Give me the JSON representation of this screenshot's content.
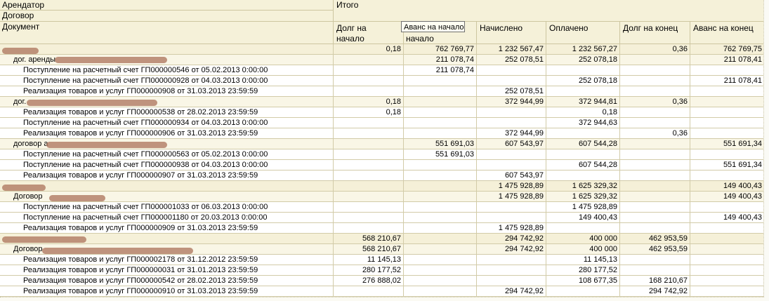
{
  "header": {
    "level1": "Арендатор",
    "level2": "Договор",
    "level3": "Документ",
    "group_title": "Итого",
    "columns": [
      "Долг на начало",
      "Аванс на начало",
      "Начислено",
      "Оплачено",
      "Долг на конец",
      "Аванс на конец"
    ],
    "col_debt_start_l1": "Долг на",
    "col_debt_start_l2": "начало",
    "col_adv_start_l2": "начало"
  },
  "tooltip": "Аванс на начало",
  "rows": [
    {
      "level": 1,
      "name": "",
      "v": [
        "0,18",
        "762 769,77",
        "1 232 567,47",
        "1 232 567,27",
        "0,36",
        "762 769,75"
      ]
    },
    {
      "level": 2,
      "name": "дог. аренды",
      "v": [
        "",
        "211 078,74",
        "252 078,51",
        "252 078,18",
        "",
        "211 078,41"
      ]
    },
    {
      "level": 3,
      "name": "Поступление на расчетный счет ГП000000546 от 05.02.2013 0:00:00",
      "v": [
        "",
        "211 078,74",
        "",
        "",
        "",
        ""
      ]
    },
    {
      "level": 3,
      "name": "Поступление на расчетный счет ГП000000928 от 04.03.2013 0:00:00",
      "v": [
        "",
        "",
        "",
        "252 078,18",
        "",
        "211 078,41"
      ]
    },
    {
      "level": 3,
      "name": "Реализация товаров и услуг ГП000000908 от 31.03.2013 23:59:59",
      "v": [
        "",
        "",
        "252 078,51",
        "",
        "",
        ""
      ]
    },
    {
      "level": 2,
      "name": "дог.",
      "v": [
        "0,18",
        "",
        "372 944,99",
        "372 944,81",
        "0,36",
        ""
      ]
    },
    {
      "level": 3,
      "name": "Реализация товаров и услуг ГП000000538 от 28.02.2013 23:59:59",
      "v": [
        "0,18",
        "",
        "",
        "0,18",
        "",
        ""
      ]
    },
    {
      "level": 3,
      "name": "Поступление на расчетный счет ГП000000934 от 04.03.2013 0:00:00",
      "v": [
        "",
        "",
        "",
        "372 944,63",
        "",
        ""
      ]
    },
    {
      "level": 3,
      "name": "Реализация товаров и услуг ГП000000906 от 31.03.2013 23:59:59",
      "v": [
        "",
        "",
        "372 944,99",
        "",
        "0,36",
        ""
      ]
    },
    {
      "level": 2,
      "name": "договор а",
      "v": [
        "",
        "551 691,03",
        "607 543,97",
        "607 544,28",
        "",
        "551 691,34"
      ]
    },
    {
      "level": 3,
      "name": "Поступление на расчетный счет ГП000000563 от 05.02.2013 0:00:00",
      "v": [
        "",
        "551 691,03",
        "",
        "",
        "",
        ""
      ]
    },
    {
      "level": 3,
      "name": "Поступление на расчетный счет ГП000000938 от 04.03.2013 0:00:00",
      "v": [
        "",
        "",
        "",
        "607 544,28",
        "",
        "551 691,34"
      ]
    },
    {
      "level": 3,
      "name": "Реализация товаров и услуг ГП000000907 от 31.03.2013 23:59:59",
      "v": [
        "",
        "",
        "607 543,97",
        "",
        "",
        ""
      ]
    },
    {
      "level": 1,
      "name": "",
      "v": [
        "",
        "",
        "1 475 928,89",
        "1 625 329,32",
        "",
        "149 400,43"
      ]
    },
    {
      "level": 2,
      "name": "Договор",
      "v": [
        "",
        "",
        "1 475 928,89",
        "1 625 329,32",
        "",
        "149 400,43"
      ]
    },
    {
      "level": 3,
      "name": "Поступление на расчетный счет ГП000001033 от 06.03.2013 0:00:00",
      "v": [
        "",
        "",
        "",
        "1 475 928,89",
        "",
        ""
      ]
    },
    {
      "level": 3,
      "name": "Поступление на расчетный счет ГП000001180 от 20.03.2013 0:00:00",
      "v": [
        "",
        "",
        "",
        "149 400,43",
        "",
        "149 400,43"
      ]
    },
    {
      "level": 3,
      "name": "Реализация товаров и услуг ГП000000909 от 31.03.2013 23:59:59",
      "v": [
        "",
        "",
        "1 475 928,89",
        "",
        "",
        ""
      ]
    },
    {
      "level": 1,
      "name": "",
      "v": [
        "568 210,67",
        "",
        "294 742,92",
        "400 000",
        "462 953,59",
        ""
      ]
    },
    {
      "level": 2,
      "name": "Договор",
      "v": [
        "568 210,67",
        "",
        "294 742,92",
        "400 000",
        "462 953,59",
        ""
      ]
    },
    {
      "level": 3,
      "name": "Реализация товаров и услуг ГП000002178 от 31.12.2012 23:59:59",
      "v": [
        "11 145,13",
        "",
        "",
        "11 145,13",
        "",
        ""
      ]
    },
    {
      "level": 3,
      "name": "Реализация товаров и услуг ГП000000031 от 31.01.2013 23:59:59",
      "v": [
        "280 177,52",
        "",
        "",
        "280 177,52",
        "",
        ""
      ]
    },
    {
      "level": 3,
      "name": "Реализация товаров и услуг ГП000000542 от 28.02.2013 23:59:59",
      "v": [
        "276 888,02",
        "",
        "",
        "108 677,35",
        "168 210,67",
        ""
      ]
    },
    {
      "level": 3,
      "name": "Реализация товаров и услуг ГП000000910 от 31.03.2013 23:59:59",
      "v": [
        "",
        "",
        "294 742,92",
        "",
        "294 742,92",
        ""
      ]
    }
  ]
}
